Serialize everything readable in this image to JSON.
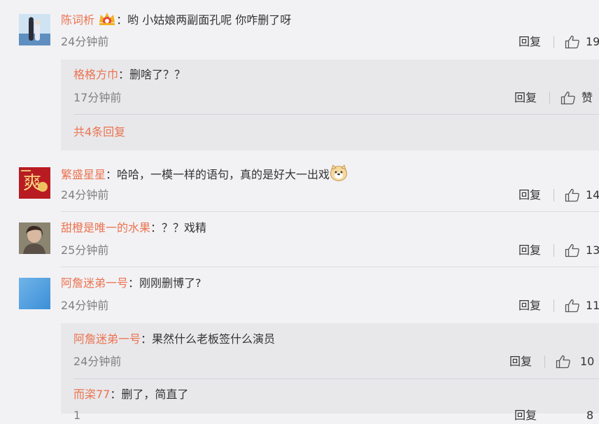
{
  "comments": [
    {
      "user": "陈词析",
      "text": "哟  小姑娘两副面孔呢  你咋删了呀",
      "time": "24分钟前",
      "reply_label": "回复",
      "likes": "19",
      "replies": [
        {
          "user": "格格方巾",
          "text": "删啥了？？",
          "time": "17分钟前",
          "reply_label": "回复",
          "likes": "赞"
        }
      ],
      "more_label": "共4条回复"
    },
    {
      "user": "繁盛星星",
      "text": "哈哈，一模一样的语句，真的是好大一出戏",
      "time": "24分钟前",
      "reply_label": "回复",
      "likes": "14",
      "avatar_text": "爽"
    },
    {
      "user": "甜橙是唯一的水果",
      "text": "？？戏精",
      "time": "25分钟前",
      "reply_label": "回复",
      "likes": "13"
    },
    {
      "user": "阿詹迷弟一号",
      "text": "刚刚删博了?",
      "time": "24分钟前",
      "reply_label": "回复",
      "likes": "11",
      "replies": [
        {
          "user": "阿詹迷弟一号",
          "text": "果然什么老板签什么演员",
          "time": "24分钟前",
          "reply_label": "回复",
          "likes": "10"
        },
        {
          "user": "而栥77",
          "text": "删了，简直了",
          "time": "1",
          "reply_label": "回复",
          "likes": "8"
        }
      ]
    }
  ],
  "colon": "：",
  "colors": {
    "name": "#eb7350",
    "background": "#f2f2f5",
    "reply_box": "#e8e8eb"
  }
}
